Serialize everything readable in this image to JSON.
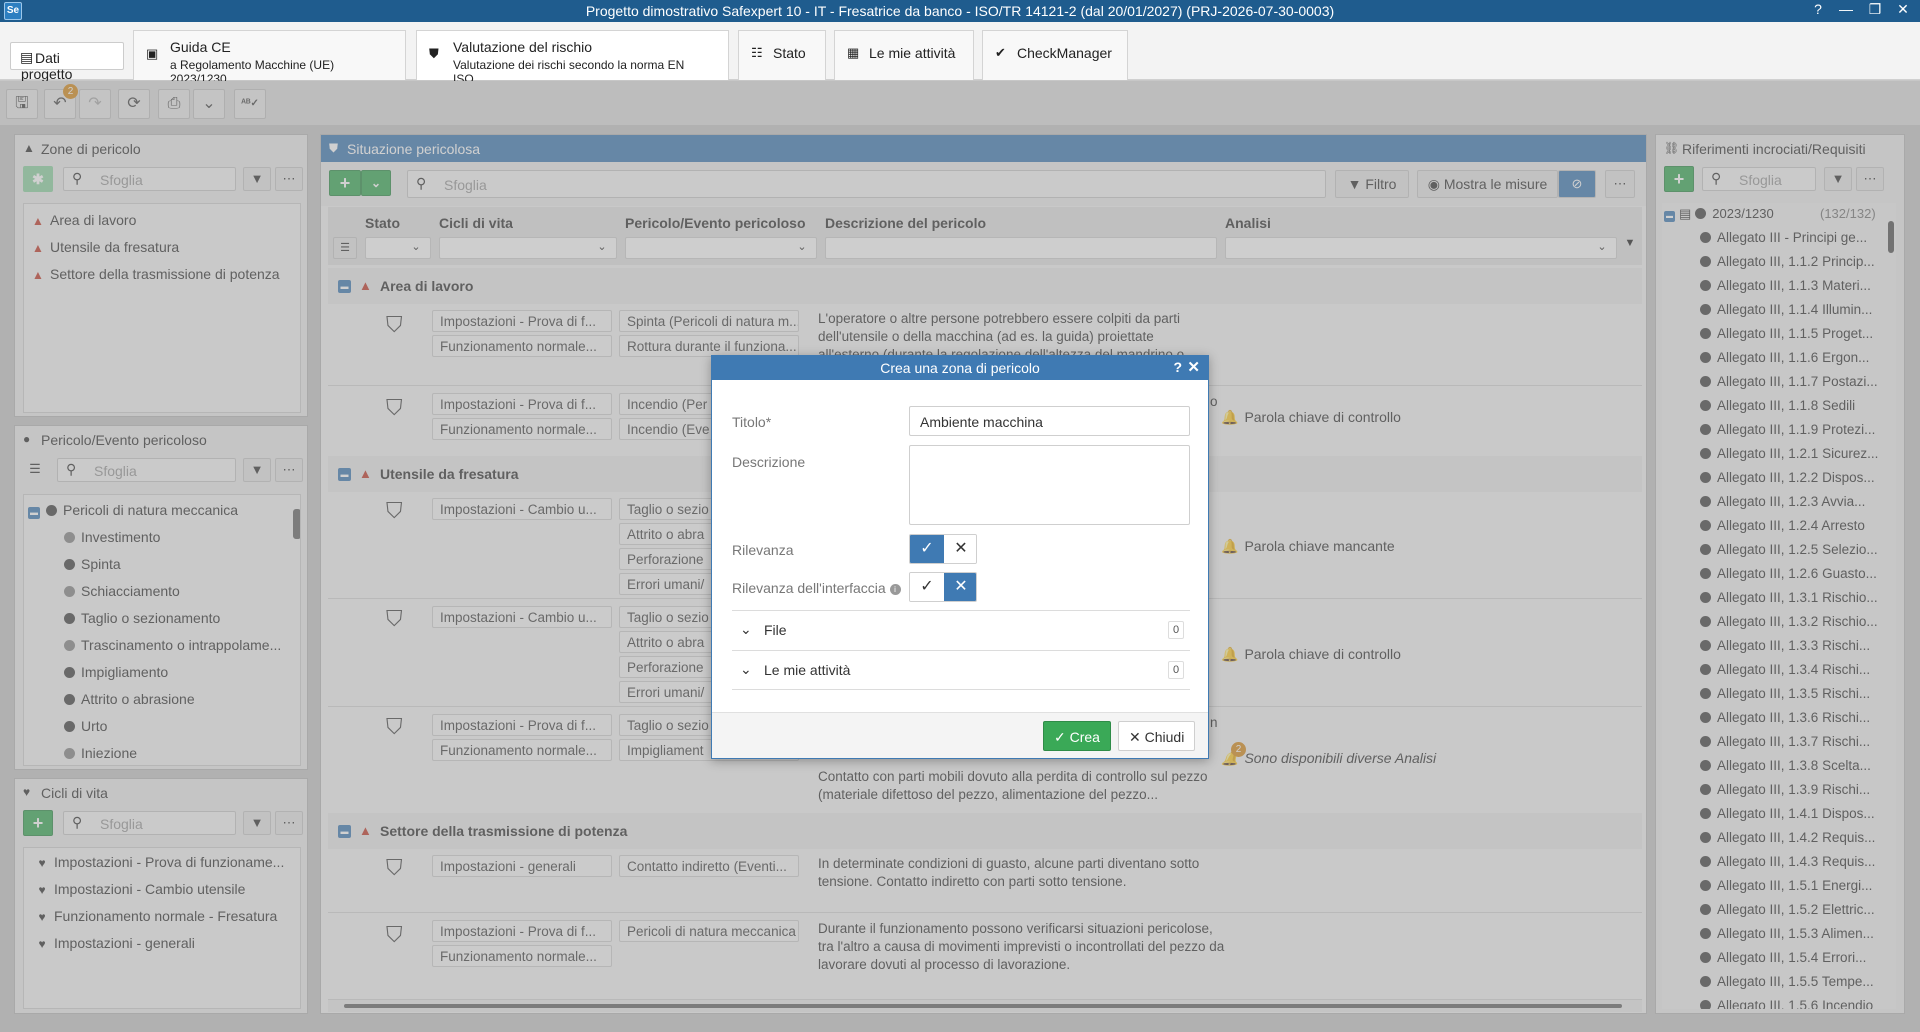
{
  "window": {
    "title": "Progetto dimostrativo Safexpert 10 - IT - Fresatrice da banco - ISO/TR 14121-2 (dal 20/01/2027) (PRJ-2026-07-30-0003)",
    "logo": "Se",
    "help": "?",
    "minimize": "—",
    "restore": "❐",
    "close": "✕"
  },
  "tabs": {
    "dati_progetto": "Dati progetto",
    "guida_ce": {
      "line1": "Guida CE",
      "line2": "a Regolamento Macchine (UE) 2023/1230"
    },
    "valutazione": {
      "line1": "Valutazione del rischio",
      "line2": "Valutazione dei rischi secondo la norma EN ISO..."
    },
    "stato": "Stato",
    "mie_attivita": "Le mie attività",
    "checkmanager": "CheckManager"
  },
  "toolbar": {
    "undo_badge": "2"
  },
  "zone_panel": {
    "title": "Zone di pericolo",
    "search_placeholder": "Sfoglia",
    "items": [
      "Area di lavoro",
      "Utensile da fresatura",
      "Settore della trasmissione di potenza"
    ]
  },
  "hazard_panel": {
    "title": "Pericolo/Evento pericoloso",
    "search_placeholder": "Sfoglia",
    "root": "Pericoli di natura meccanica",
    "items": [
      "Investimento",
      "Spinta",
      "Schiacciamento",
      "Taglio o sezionamento",
      "Trascinamento o intrappolame...",
      "Impigliamento",
      "Attrito o abrasione",
      "Urto",
      "Iniezione"
    ]
  },
  "lifecycle_panel": {
    "title": "Cicli di vita",
    "search_placeholder": "Sfoglia",
    "items": [
      "Impostazioni - Prova di funzioname...",
      "Impostazioni - Cambio utensile",
      "Funzionamento normale - Fresatura",
      "Impostazioni - generali"
    ]
  },
  "center": {
    "title": "Situazione pericolosa",
    "search_placeholder": "Sfoglia",
    "filter_label": "Filtro",
    "show_measures_label": "Mostra le misure",
    "columns": {
      "stato": "Stato",
      "cicli": "Cicli di vita",
      "pericolo": "Pericolo/Evento pericoloso",
      "descrizione": "Descrizione del pericolo",
      "analisi": "Analisi"
    },
    "groups": [
      {
        "label": "Area di lavoro"
      },
      {
        "label": "Utensile da fresatura"
      },
      {
        "label": "Settore della trasmissione di potenza"
      }
    ],
    "rows": [
      {
        "cicli": [
          "Impostazioni - Prova di f...",
          "Funzionamento normale..."
        ],
        "pericolo": [
          "Spinta (Pericoli di natura m...",
          "Rottura durante il funziona..."
        ],
        "desc": "L'operatore o altre persone potrebbero essere colpiti da parti dell'utensile o della macchina (ad es. la guida) proiettate all'esterno (durante la regolazione dell'altezza del mandrino o",
        "analisi": ""
      },
      {
        "cicli": [
          "Impostazioni - Prova di f...",
          "Funzionamento normale..."
        ],
        "pericolo": [
          "Incendio (Per",
          "Incendio (Eve"
        ],
        "desc": "",
        "desc_tail": "o",
        "analisi": "Parola chiave di controllo"
      },
      {
        "cicli": [
          "Impostazioni - Cambio u..."
        ],
        "pericolo": [
          "Taglio o sezio",
          "Attrito o abra",
          "Perforazione",
          "Errori umani/"
        ],
        "desc": "",
        "analisi": "Parola chiave mancante"
      },
      {
        "cicli": [
          "Impostazioni - Cambio u..."
        ],
        "pericolo": [
          "Taglio o sezio",
          "Attrito o abra",
          "Perforazione",
          "Errori umani/"
        ],
        "desc": "",
        "analisi": "Parola chiave di controllo"
      },
      {
        "cicli": [
          "Impostazioni - Prova di f...",
          "Funzionamento normale..."
        ],
        "pericolo": [
          "Taglio o sezio",
          "Impigliament"
        ],
        "desc": "Contatto con parti mobili dovuto alla perdita di controllo sul pezzo (materiale difettoso del pezzo, alimentazione del pezzo...",
        "desc_tail": "n",
        "analisi": "Sono disponibili diverse Analisi",
        "badge": "2"
      },
      {
        "cicli": [
          "Impostazioni - generali"
        ],
        "pericolo": [
          "Contatto indiretto (Eventi..."
        ],
        "desc": "In determinate condizioni di guasto, alcune parti diventano sotto tensione. Contatto indiretto con parti sotto tensione.",
        "analisi": ""
      },
      {
        "cicli": [
          "Impostazioni - Prova di f...",
          "Funzionamento normale..."
        ],
        "pericolo": [
          "Pericoli di natura meccanica"
        ],
        "desc": "Durante il funzionamento possono verificarsi situazioni pericolose, tra l'altro a causa di movimenti imprevisti o incontrollati del pezzo da lavorare dovuti al processo di lavorazione.",
        "analisi": ""
      }
    ]
  },
  "right_panel": {
    "title": "Riferimenti incrociati/Requisiti",
    "search_placeholder": "Sfoglia",
    "root": "2023/1230",
    "count": "(132/132)",
    "items": [
      "Allegato III - Principi ge...",
      "Allegato III, 1.1.2 Princip...",
      "Allegato III, 1.1.3 Materi...",
      "Allegato III, 1.1.4 Illumin...",
      "Allegato III, 1.1.5 Proget...",
      "Allegato III, 1.1.6 Ergon...",
      "Allegato III, 1.1.7 Postazi...",
      "Allegato III, 1.1.8 Sedili",
      "Allegato III, 1.1.9 Protezi...",
      "Allegato III, 1.2.1 Sicurez...",
      "Allegato III, 1.2.2 Dispos...",
      "Allegato III, 1.2.3 Avvia...",
      "Allegato III, 1.2.4 Arresto",
      "Allegato III, 1.2.5 Selezio...",
      "Allegato III, 1.2.6 Guasto...",
      "Allegato III, 1.3.1 Rischio...",
      "Allegato III, 1.3.2 Rischio...",
      "Allegato III, 1.3.3 Rischi...",
      "Allegato III, 1.3.4 Rischi...",
      "Allegato III, 1.3.5 Rischi...",
      "Allegato III, 1.3.6 Rischi...",
      "Allegato III, 1.3.7 Rischi...",
      "Allegato III, 1.3.8 Scelta...",
      "Allegato III, 1.3.9 Rischi...",
      "Allegato III, 1.4.1 Dispos...",
      "Allegato III, 1.4.2 Requis...",
      "Allegato III, 1.4.3 Requis...",
      "Allegato III, 1.5.1 Energi...",
      "Allegato III, 1.5.2 Elettric...",
      "Allegato III, 1.5.3 Alimen...",
      "Allegato III, 1.5.4 Errori...",
      "Allegato III, 1.5.5 Tempe...",
      "Allegato III, 1.5.6 Incendio"
    ]
  },
  "dialog": {
    "title": "Crea una zona di pericolo",
    "help": "?",
    "close": "✕",
    "titolo_label": "Titolo*",
    "titolo_value": "Ambiente macchina",
    "descrizione_label": "Descrizione",
    "descrizione_value": "",
    "rilevanza_label": "Rilevanza",
    "rilevanza_interfaccia_label": "Rilevanza dell'interfaccia",
    "file_label": "File",
    "file_count": "0",
    "attivita_label": "Le mie attività",
    "attivita_count": "0",
    "crea_label": "Crea",
    "chiudi_label": "Chiudi"
  }
}
